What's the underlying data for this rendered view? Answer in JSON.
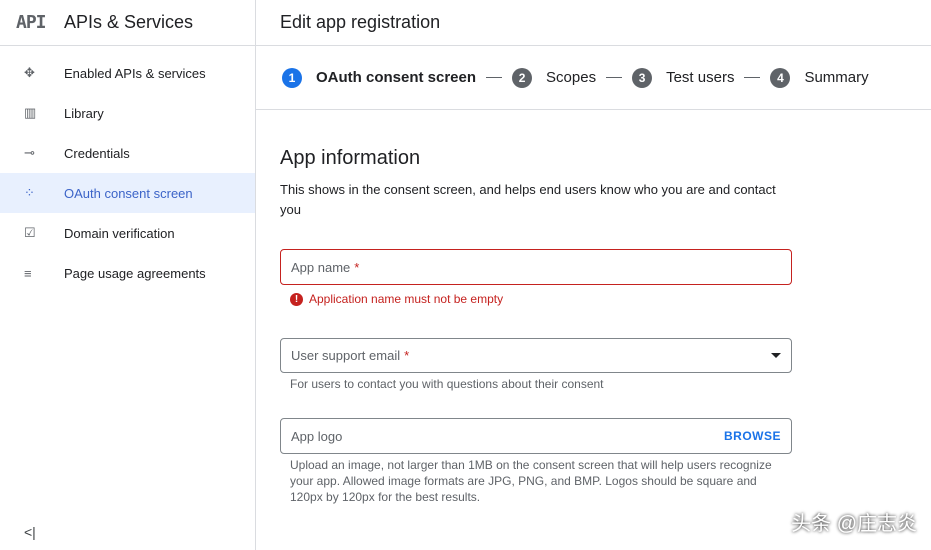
{
  "sidebar": {
    "logo": "API",
    "title": "APIs & Services",
    "items": [
      {
        "label": "Enabled APIs & services",
        "icon": "✥"
      },
      {
        "label": "Library",
        "icon": "▥"
      },
      {
        "label": "Credentials",
        "icon": "⊸"
      },
      {
        "label": "OAuth consent screen",
        "icon": "⁘"
      },
      {
        "label": "Domain verification",
        "icon": "☑"
      },
      {
        "label": "Page usage agreements",
        "icon": "≡"
      }
    ],
    "collapse": "<|"
  },
  "header": {
    "title": "Edit app registration"
  },
  "steps": [
    {
      "n": "1",
      "label": "OAuth consent screen"
    },
    {
      "n": "2",
      "label": "Scopes"
    },
    {
      "n": "3",
      "label": "Test users"
    },
    {
      "n": "4",
      "label": "Summary"
    }
  ],
  "form": {
    "title": "App information",
    "description": "This shows in the consent screen, and helps end users know who you are and contact you",
    "app_name": {
      "label": "App name",
      "req": "*",
      "error": "Application name must not be empty",
      "error_icon": "!"
    },
    "email": {
      "label": "User support email",
      "req": "*",
      "hint": "For users to contact you with questions about their consent"
    },
    "logo": {
      "label": "App logo",
      "button": "BROWSE",
      "hint": "Upload an image, not larger than 1MB on the consent screen that will help users recognize your app. Allowed image formats are JPG, PNG, and BMP. Logos should be square and 120px by 120px for the best results."
    }
  },
  "watermark": "头条 @庄志炎"
}
